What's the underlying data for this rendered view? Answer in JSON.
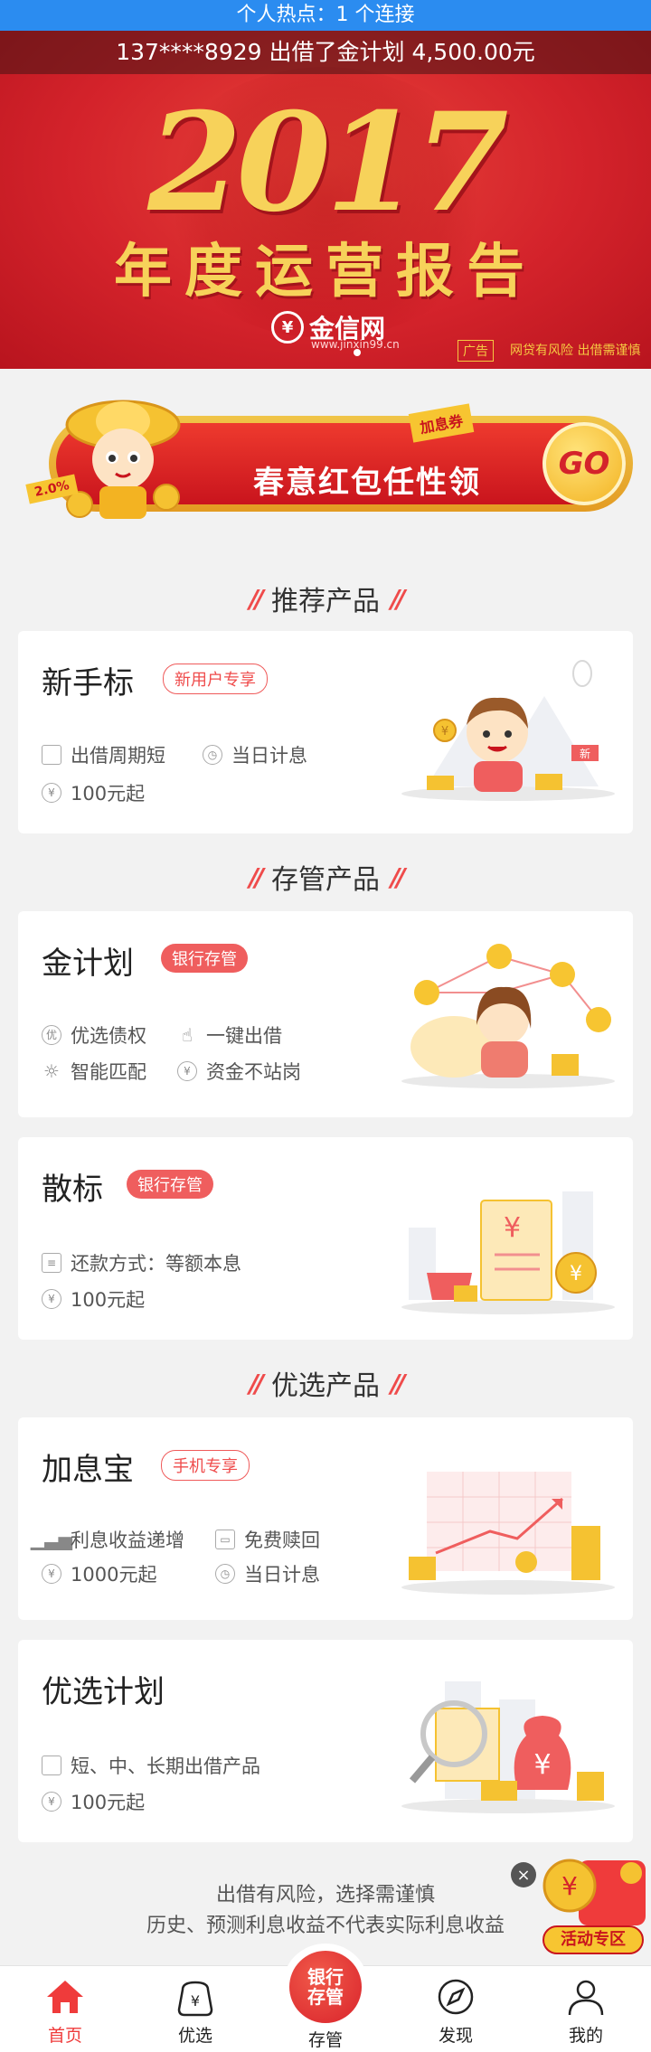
{
  "status": {
    "hotspot_text": "个人热点：1 个连接"
  },
  "banner": {
    "ticker": "137****8929  出借了金计划  4,500.00元",
    "year": "2017",
    "headline": "年度运营报告",
    "brand_name": "金信网",
    "brand_url": "www.jinxin99.cn",
    "ad_tag": "广告",
    "ad_risk": "网贷有风险 出借需谨慎"
  },
  "promo": {
    "text": "春意红包任性领",
    "go": "GO",
    "coupon_tag": "加息券",
    "rate_tag": "2.0%"
  },
  "sections": {
    "recommended": "推荐产品",
    "custody": "存管产品",
    "selected": "优选产品"
  },
  "cards": {
    "newbie": {
      "title": "新手标",
      "badge": "新用户专享",
      "f1": "出借周期短",
      "f2": "当日计息",
      "f3": "100元起",
      "illus_flag": "新"
    },
    "gold_plan": {
      "title": "金计划",
      "badge": "银行存管",
      "f1": "优选债权",
      "f2": "一键出借",
      "f3": "智能匹配",
      "f4": "资金不站岗"
    },
    "loose": {
      "title": "散标",
      "badge": "银行存管",
      "f1": "还款方式：等额本息",
      "f2": "100元起"
    },
    "jiaxi": {
      "title": "加息宝",
      "badge": "手机专享",
      "f1": "利息收益递增",
      "f2": "免费赎回",
      "f3": "1000元起",
      "f4": "当日计息"
    },
    "selected_plan": {
      "title": "优选计划",
      "f1": "短、中、长期出借产品",
      "f2": "100元起"
    }
  },
  "disclaimer": {
    "line1": "出借有风险，选择需谨慎",
    "line2": "历史、预测利息收益不代表实际利息收益"
  },
  "floating": {
    "label": "活动专区"
  },
  "tabbar": {
    "home": "首页",
    "selected": "优选",
    "center_line1": "银行",
    "center_line2": "存管",
    "custody": "存管",
    "discover": "发现",
    "mine": "我的"
  },
  "colors": {
    "accent": "#ef3b3b",
    "status_bar": "#2b8cf0",
    "gold": "#f7d25a"
  }
}
